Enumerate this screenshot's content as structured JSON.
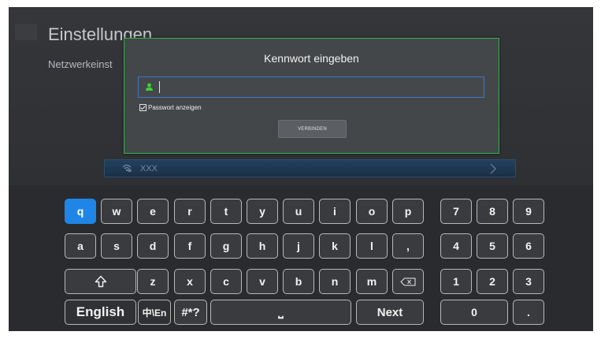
{
  "header": {
    "title": "Einstellungen",
    "subtitle": "Netzwerkeinst"
  },
  "dialog": {
    "title": "Kennwort eingeben",
    "password_value": "",
    "show_password_label": "Passwort anzeigen",
    "show_password_checked": true,
    "connect_label": "VERBINDEN"
  },
  "network": {
    "name": "XXX"
  },
  "keyboard": {
    "row1": [
      "q",
      "w",
      "e",
      "r",
      "t",
      "y",
      "u",
      "i",
      "o",
      "p"
    ],
    "row2": [
      "a",
      "s",
      "d",
      "f",
      "g",
      "h",
      "j",
      "k",
      "l",
      ","
    ],
    "row3": [
      "z",
      "x",
      "c",
      "v",
      "b",
      "n",
      "m"
    ],
    "english_label": "English",
    "lang_switch_label": "中\\En",
    "symbols_label": "#*?",
    "space_label": "⎵",
    "next_label": "Next",
    "numpad_row1": [
      "7",
      "8",
      "9"
    ],
    "numpad_row2": [
      "4",
      "5",
      "6"
    ],
    "numpad_row3": [
      "1",
      "2",
      "3"
    ],
    "numpad_zero": "0",
    "numpad_dot": ".",
    "active_key": "q"
  },
  "colors": {
    "accent": "#1f86e8",
    "dialog_border": "#2eb54b",
    "field_border": "#3d76c6",
    "user_icon": "#3ccf3c"
  }
}
